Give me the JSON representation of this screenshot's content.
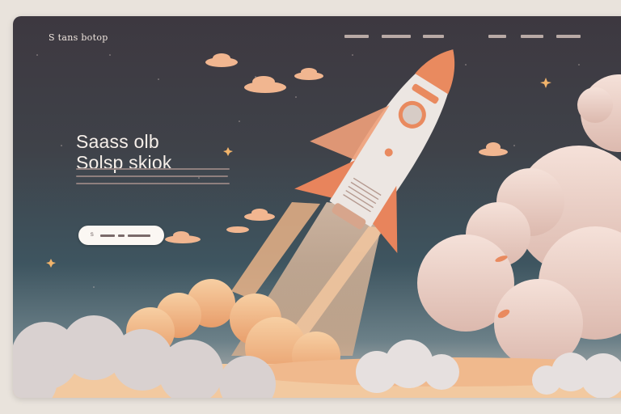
{
  "brand": {
    "name": "S tans botop"
  },
  "nav": {
    "left_links": [
      "",
      "",
      ""
    ],
    "right_links": [
      "",
      "",
      ""
    ]
  },
  "hero": {
    "headline_line1": "Saass olb",
    "headline_line2": "Solsp skiok",
    "cta_glyph": "S"
  },
  "colors": {
    "sky_top": "#3d3840",
    "sky_bottom": "#3e5560",
    "cloud": "#f0dcd4",
    "cloud_warm": "#f3c49a",
    "rocket_body": "#ece6e2",
    "rocket_accent": "#e98a5f",
    "cta_background": "#fbf7f3"
  },
  "icons": [
    "star-icon",
    "rocket-illustration"
  ]
}
